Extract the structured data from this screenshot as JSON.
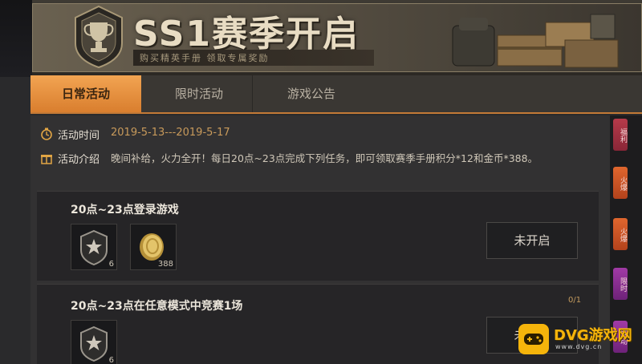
{
  "banner": {
    "title": "SS1赛季开启",
    "subtitle": "购买精英手册  领取专属奖励"
  },
  "tabs": [
    {
      "label": "日常活动",
      "active": true
    },
    {
      "label": "限时活动",
      "active": false
    },
    {
      "label": "游戏公告",
      "active": false
    }
  ],
  "activity": {
    "time_label": "活动时间",
    "time_value": "2019-5-13---2019-5-17",
    "intro_label": "活动介绍",
    "intro_value": "晚间补给，火力全开！每日20点~23点完成下列任务，即可领取赛季手册积分*12和金币*388。"
  },
  "tasks": [
    {
      "title": "20点~23点登录游戏",
      "rewards": [
        {
          "icon": "rank-badge-icon",
          "count": "6"
        },
        {
          "icon": "gold-coin-icon",
          "count": "388"
        }
      ],
      "status": "未开启",
      "progress": ""
    },
    {
      "title": "20点~23点在任意模式中竞赛1场",
      "rewards": [
        {
          "icon": "rank-badge-icon",
          "count": "6"
        }
      ],
      "status": "未开启",
      "progress": "0/1"
    }
  ],
  "side_tabs": [
    "福利",
    "火爆",
    "火爆",
    "限时",
    "活动"
  ],
  "watermark": {
    "text": "DVG游戏网",
    "url": "www.dvg.cn"
  },
  "colors": {
    "accent": "#e08e3c",
    "date": "#c89a5b",
    "watermark": "#f5b40b"
  }
}
